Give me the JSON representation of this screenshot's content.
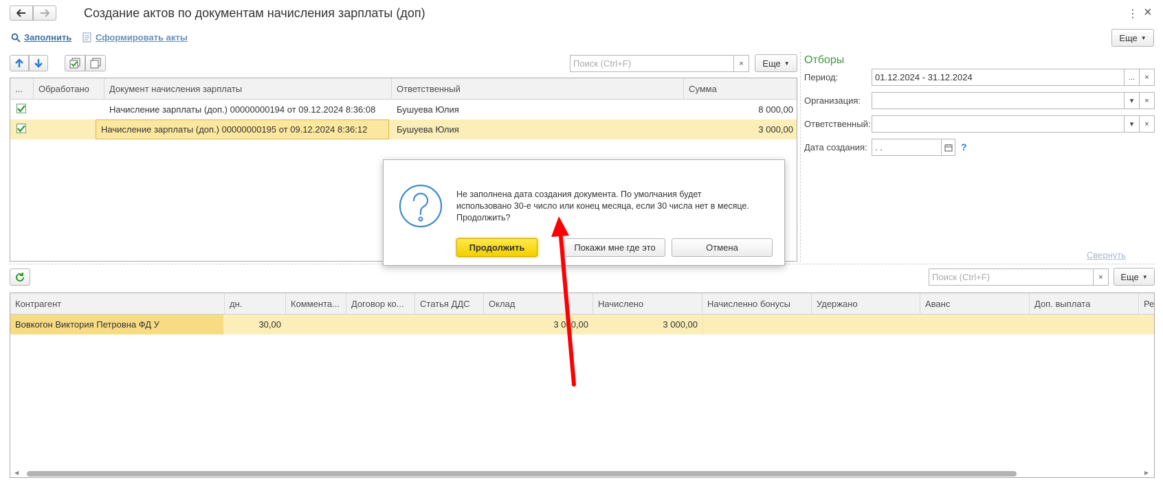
{
  "window": {
    "title": "Создание актов по документам начисления зарплаты (доп)",
    "more_menu_glyph": "⋮",
    "close_glyph": "×"
  },
  "toolbar": {
    "fill_label": "Заполнить",
    "form_acts_label": "Сформировать акты",
    "more_label": "Еще"
  },
  "upper_table": {
    "search_placeholder": "Поиск (Ctrl+F)",
    "search_clear": "×",
    "more_label": "Еще",
    "columns": [
      "...",
      "Обработано",
      "Документ начисления зарплаты",
      "Ответственный",
      "Сумма"
    ],
    "rows": [
      {
        "checked": true,
        "processed": "",
        "document": "Начисление зарплаты (доп.) 00000000194 от 09.12.2024 8:36:08",
        "responsible": "Бушуева Юлия",
        "sum": "8 000,00"
      },
      {
        "checked": true,
        "processed": "",
        "document": "Начисление зарплаты (доп.) 00000000195 от 09.12.2024 8:36:12",
        "responsible": "Бушуева Юлия",
        "sum": "3 000,00"
      }
    ]
  },
  "filters": {
    "title": "Отборы",
    "period_label": "Период:",
    "period_value": "01.12.2024 - 31.12.2024",
    "org_label": "Организация:",
    "org_value": "",
    "resp_label": "Ответственный:",
    "resp_value": "",
    "date_label": "Дата создания:",
    "date_value": " .  .",
    "help": "?",
    "collapse_label": "Свернуть",
    "dots": "...",
    "clear": "×",
    "dropdown": "▾"
  },
  "lower_table": {
    "search_placeholder": "Поиск (Ctrl+F)",
    "search_clear": "×",
    "more_label": "Еще",
    "columns": [
      "Контрагент",
      "дн.",
      "Коммента...",
      "Договор ко...",
      "Статья ДДС",
      "Оклад",
      "Начислено",
      "Начисленно бонусы",
      "Удержано",
      "Аванс",
      "Доп. выплата",
      "Рез"
    ],
    "rows": [
      {
        "counterparty": "Вовкогон Виктория Петровна ФД У",
        "days": "30,00",
        "comment": "",
        "contract": "",
        "dds": "",
        "salary": "3 000,00",
        "accrued": "3 000,00",
        "bonus": "",
        "withheld": "",
        "advance": "",
        "extra": "",
        "res": ""
      }
    ]
  },
  "dialog": {
    "message": "Не заполнена дата создания документа. По умолчания будет использовано 30-е число или конец месяца, если 30 числа нет в месяце. Продолжить?",
    "continue_label": "Продолжить",
    "show_me_label": "Покажи мне где это",
    "cancel_label": "Отмена",
    "icon_glyph": "?"
  },
  "colors": {
    "accent_green": "#3a9a3a",
    "selection": "#fbeeb8",
    "primary_button": "#f5d800",
    "arrow_red": "#ff0000"
  }
}
